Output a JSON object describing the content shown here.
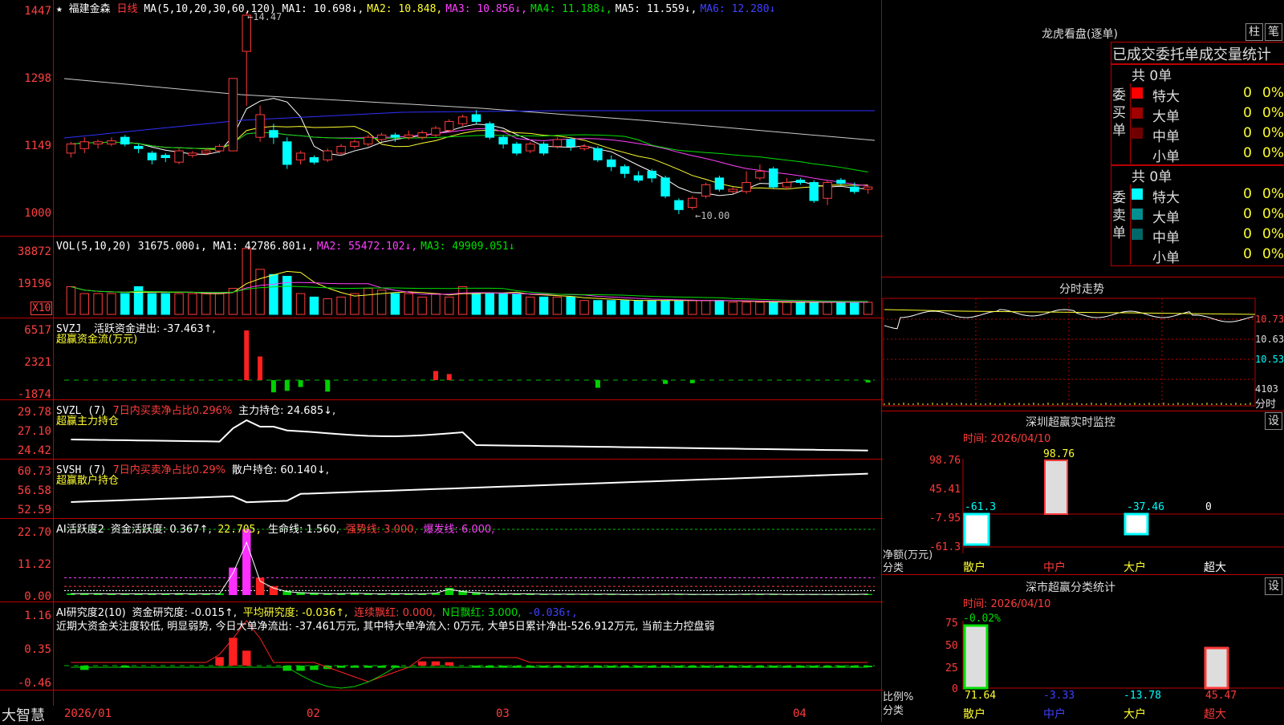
{
  "stock": {
    "star": "★",
    "name": "福建金森",
    "period": "日线"
  },
  "ma_legend": {
    "label": "MA(5,10,20,30,60,120)",
    "items": [
      {
        "t": "MA1: 10.698↓,",
        "color": "#ffffff"
      },
      {
        "t": "MA2: 10.848,",
        "color": "#ffff30"
      },
      {
        "t": "MA3: 10.856↓,",
        "color": "#ff40ff"
      },
      {
        "t": "MA4: 11.188↓,",
        "color": "#00e000"
      },
      {
        "t": "MA5: 11.559↓,",
        "color": "#ffffff"
      },
      {
        "t": "MA6: 12.280↓",
        "color": "#4040ff"
      }
    ]
  },
  "price_axis": [
    "1447",
    "1298",
    "1149",
    "1000"
  ],
  "price_marks": {
    "high": "14.47",
    "low": "10.00"
  },
  "vol_legend": {
    "label": "VOL(5,10,20)",
    "value": "31675.000↓,",
    "items": [
      {
        "t": "MA1: 42786.801↓,",
        "color": "#ffffff"
      },
      {
        "t": "MA2: 55472.102↓,",
        "color": "#ff40ff"
      },
      {
        "t": "MA3: 49909.051↓",
        "color": "#00e000"
      }
    ]
  },
  "vol_axis": [
    "38872",
    "19196"
  ],
  "vol_unit": "X10",
  "svzj": {
    "label": "SVZJ",
    "title": "活跃资金进出: -37.463↑,",
    "sub": "超赢资金流(万元)",
    "axis": [
      "6517",
      "2321",
      "-1874"
    ]
  },
  "svzl": {
    "label": "SVZL (7)",
    "a": "7日内买卖净占比0.296%",
    "b": "主力持仓: 24.685↓,",
    "sub": "超赢主力持仓",
    "axis": [
      "29.78",
      "27.10",
      "24.42"
    ]
  },
  "svsh": {
    "label": "SVSH (7)",
    "a": "7日内买卖净占比0.29%",
    "b": "散户持仓: 60.140↓,",
    "sub": "超赢散户持仓",
    "axis": [
      "60.73",
      "56.58",
      "52.59"
    ]
  },
  "ai1": {
    "label": "AI活跃度2",
    "a": "资金活跃度: 0.367↑,",
    "b": "22.705,",
    "c": "生命线: 1.560,",
    "d": "强势线: 3.000,",
    "e": "爆发线: 6.000,",
    "axis": [
      "22.70",
      "11.22",
      "0.00"
    ]
  },
  "ai2": {
    "label": "AI研究度2(10)",
    "a": "资金研究度: -0.015↑,",
    "b": "平均研究度: -0.036↑,",
    "c": "连续飘红: 0.000,",
    "d": "N日飘红: 3.000,",
    "e": "-0.036↑,",
    "axis": [
      "1.16",
      "0.35",
      "-0.46"
    ],
    "comment": "近期大资金关注度较低, 明显弱势, 今日大单净流出: -37.461万元, 其中特大单净流入: 0万元, 大单5日累计净出-526.912万元, 当前主力控盘弱"
  },
  "xaxis": {
    "brand": "大智慧",
    "labels": [
      "2026/01",
      "02",
      "03",
      "04"
    ]
  },
  "side": {
    "lh_title": "龙虎看盘(逐单)",
    "btn_zhu": "柱",
    "btn_bi": "笔",
    "tabs": "已成交委托单成交量统计",
    "buy": {
      "side": "委买单",
      "total": "共 0单",
      "rows": [
        {
          "label": "特大",
          "n": "0",
          "p": "0%",
          "color": "#ff0000"
        },
        {
          "label": "大单",
          "n": "0",
          "p": "0%",
          "color": "#a00000"
        },
        {
          "label": "中单",
          "n": "0",
          "p": "0%",
          "color": "#700000"
        },
        {
          "label": "小单",
          "n": "0",
          "p": "0%",
          "color": "#000000"
        }
      ]
    },
    "sell": {
      "side": "委卖单",
      "total": "共 0单",
      "rows": [
        {
          "label": "特大",
          "n": "0",
          "p": "0%",
          "color": "#00ffff"
        },
        {
          "label": "大单",
          "n": "0",
          "p": "0%",
          "color": "#009090"
        },
        {
          "label": "中单",
          "n": "0",
          "p": "0%",
          "color": "#006868"
        },
        {
          "label": "小单",
          "n": "0",
          "p": "0%",
          "color": "#000000"
        }
      ]
    },
    "fs_title": "分时走势",
    "fs_axis": [
      "10.73",
      "10.63",
      "10.53",
      "4103",
      "分时"
    ],
    "sz_title": "深圳超赢实时监控",
    "sz_set": "设",
    "sz_time": "时间: 2026/04/10",
    "sz_axis": [
      "98.76",
      "45.41",
      "-7.95",
      "-61.3"
    ],
    "sz_ylabel": "净额(万元)",
    "sz_xlabel": "分类",
    "sz_values": {
      "sanhu": "-61.3",
      "zhonghu": "98.76",
      "dahu": "-37.46",
      "chaoda": "0"
    },
    "cats": [
      "散户",
      "中户",
      "大户",
      "超大"
    ],
    "ss_title": "深市超赢分类统计",
    "ss_set": "设",
    "ss_time": "时间: 2026/04/10",
    "ss_axis": [
      "75",
      "50",
      "25",
      "0"
    ],
    "ss_top": "-0.02%",
    "ss_ylabel": "比例%",
    "ss_xlabel": "分类",
    "ss_values": [
      "71.64",
      "-3.33",
      "-13.78",
      "45.47"
    ]
  },
  "chart_data": {
    "type": "candlestick",
    "high": 14.47,
    "low": 10.0,
    "candles": [
      {
        "o": 11.35,
        "c": 11.55,
        "h": 11.6,
        "l": 11.25
      },
      {
        "o": 11.45,
        "c": 11.6,
        "h": 11.7,
        "l": 11.35
      },
      {
        "o": 11.55,
        "c": 11.6,
        "h": 11.65,
        "l": 11.45
      },
      {
        "o": 11.55,
        "c": 11.62,
        "h": 11.7,
        "l": 11.5
      },
      {
        "o": 11.7,
        "c": 11.55,
        "h": 11.75,
        "l": 11.5
      },
      {
        "o": 11.5,
        "c": 11.45,
        "h": 11.55,
        "l": 11.35
      },
      {
        "o": 11.35,
        "c": 11.2,
        "h": 11.4,
        "l": 11.1
      },
      {
        "o": 11.3,
        "c": 11.25,
        "h": 11.35,
        "l": 11.15
      },
      {
        "o": 11.15,
        "c": 11.4,
        "h": 11.45,
        "l": 11.1
      },
      {
        "o": 11.3,
        "c": 11.35,
        "h": 11.4,
        "l": 11.25
      },
      {
        "o": 11.35,
        "c": 11.4,
        "h": 11.45,
        "l": 11.3
      },
      {
        "o": 11.4,
        "c": 11.5,
        "h": 11.55,
        "l": 11.35
      },
      {
        "o": 11.4,
        "c": 13.0,
        "h": 13.0,
        "l": 11.4
      },
      {
        "o": 13.6,
        "c": 14.4,
        "h": 14.47,
        "l": 12.4
      },
      {
        "o": 11.7,
        "c": 12.2,
        "h": 12.4,
        "l": 11.6
      },
      {
        "o": 11.85,
        "c": 11.7,
        "h": 12.0,
        "l": 11.55
      },
      {
        "o": 11.6,
        "c": 11.1,
        "h": 11.7,
        "l": 11.0
      },
      {
        "o": 11.2,
        "c": 11.35,
        "h": 11.4,
        "l": 11.1
      },
      {
        "o": 11.25,
        "c": 11.15,
        "h": 11.3,
        "l": 11.1
      },
      {
        "o": 11.2,
        "c": 11.4,
        "h": 11.45,
        "l": 11.15
      },
      {
        "o": 11.35,
        "c": 11.5,
        "h": 11.55,
        "l": 11.3
      },
      {
        "o": 11.5,
        "c": 11.6,
        "h": 11.65,
        "l": 11.45
      },
      {
        "o": 11.55,
        "c": 11.7,
        "h": 11.75,
        "l": 11.5
      },
      {
        "o": 11.65,
        "c": 11.75,
        "h": 11.8,
        "l": 11.6
      },
      {
        "o": 11.75,
        "c": 11.7,
        "h": 11.8,
        "l": 11.6
      },
      {
        "o": 11.7,
        "c": 11.75,
        "h": 11.85,
        "l": 11.65
      },
      {
        "o": 11.7,
        "c": 11.8,
        "h": 11.85,
        "l": 11.65
      },
      {
        "o": 11.75,
        "c": 11.9,
        "h": 11.95,
        "l": 11.7
      },
      {
        "o": 11.85,
        "c": 12.05,
        "h": 12.1,
        "l": 11.8
      },
      {
        "o": 12.0,
        "c": 12.15,
        "h": 12.2,
        "l": 11.95
      },
      {
        "o": 12.2,
        "c": 12.05,
        "h": 12.3,
        "l": 12.0
      },
      {
        "o": 12.0,
        "c": 11.7,
        "h": 12.05,
        "l": 11.65
      },
      {
        "o": 11.7,
        "c": 11.55,
        "h": 11.75,
        "l": 11.45
      },
      {
        "o": 11.55,
        "c": 11.35,
        "h": 11.6,
        "l": 11.3
      },
      {
        "o": 11.4,
        "c": 11.55,
        "h": 11.6,
        "l": 11.35
      },
      {
        "o": 11.55,
        "c": 11.35,
        "h": 11.6,
        "l": 11.3
      },
      {
        "o": 11.5,
        "c": 11.65,
        "h": 11.7,
        "l": 11.45
      },
      {
        "o": 11.65,
        "c": 11.5,
        "h": 11.7,
        "l": 11.4
      },
      {
        "o": 11.45,
        "c": 11.5,
        "h": 11.55,
        "l": 11.4
      },
      {
        "o": 11.45,
        "c": 11.2,
        "h": 11.5,
        "l": 11.15
      },
      {
        "o": 11.2,
        "c": 11.05,
        "h": 11.3,
        "l": 10.95
      },
      {
        "o": 11.05,
        "c": 10.9,
        "h": 11.1,
        "l": 10.8
      },
      {
        "o": 10.85,
        "c": 10.75,
        "h": 10.95,
        "l": 10.7
      },
      {
        "o": 10.95,
        "c": 10.8,
        "h": 11.0,
        "l": 10.7
      },
      {
        "o": 10.8,
        "c": 10.4,
        "h": 10.85,
        "l": 10.35
      },
      {
        "o": 10.3,
        "c": 10.1,
        "h": 10.35,
        "l": 10.0
      },
      {
        "o": 10.15,
        "c": 10.35,
        "h": 10.4,
        "l": 10.1
      },
      {
        "o": 10.4,
        "c": 10.65,
        "h": 10.7,
        "l": 10.35
      },
      {
        "o": 10.8,
        "c": 10.55,
        "h": 10.85,
        "l": 10.5
      },
      {
        "o": 10.5,
        "c": 10.55,
        "h": 10.6,
        "l": 10.45
      },
      {
        "o": 10.5,
        "c": 10.7,
        "h": 10.95,
        "l": 10.45
      },
      {
        "o": 10.8,
        "c": 10.95,
        "h": 11.1,
        "l": 10.75
      },
      {
        "o": 11.0,
        "c": 10.6,
        "h": 11.05,
        "l": 10.55
      },
      {
        "o": 10.6,
        "c": 10.7,
        "h": 10.8,
        "l": 10.55
      },
      {
        "o": 10.75,
        "c": 10.7,
        "h": 10.8,
        "l": 10.65
      },
      {
        "o": 10.7,
        "c": 10.3,
        "h": 10.75,
        "l": 10.25
      },
      {
        "o": 10.35,
        "c": 10.7,
        "h": 10.75,
        "l": 10.2
      },
      {
        "o": 10.75,
        "c": 10.68,
        "h": 10.8,
        "l": 10.65
      },
      {
        "o": 10.6,
        "c": 10.5,
        "h": 10.7,
        "l": 10.45
      },
      {
        "o": 10.55,
        "c": 10.6,
        "h": 10.65,
        "l": 10.45
      }
    ],
    "volume": [
      16,
      12,
      12,
      12,
      12,
      16,
      12,
      12,
      12,
      12,
      12,
      12,
      15,
      38,
      26,
      23,
      22,
      12,
      10,
      9,
      10,
      12,
      15,
      14,
      12,
      12,
      10,
      12,
      10,
      16,
      12,
      12,
      12,
      12,
      10,
      10,
      10,
      10,
      8,
      8,
      8,
      8,
      8,
      8,
      8,
      8,
      8,
      8,
      8,
      7,
      7,
      7,
      7,
      7,
      7,
      7,
      7,
      7,
      7,
      7
    ],
    "svzj": [
      0,
      0,
      0,
      0,
      0,
      0,
      0,
      0,
      0,
      0,
      0,
      0,
      0,
      6517,
      3100,
      -1600,
      -1400,
      -900,
      0,
      -1500,
      0,
      0,
      0,
      0,
      0,
      0,
      0,
      1200,
      800,
      0,
      0,
      0,
      0,
      0,
      0,
      0,
      0,
      0,
      0,
      -1000,
      0,
      0,
      0,
      0,
      -500,
      0,
      -400,
      0,
      0,
      0,
      0,
      0,
      0,
      0,
      0,
      0,
      0,
      0,
      0,
      -300
    ],
    "ai1": [
      0.6,
      0.6,
      0.6,
      0.5,
      0.5,
      0.5,
      0.5,
      0.5,
      0.6,
      0.5,
      0.5,
      0.6,
      9.5,
      22.7,
      6.0,
      3.0,
      1.5,
      1.0,
      0.8,
      0.6,
      0.6,
      0.8,
      0.6,
      0.5,
      0.6,
      0.5,
      0.5,
      0.8,
      2.5,
      1.5,
      1.0,
      0.6,
      0.5,
      0.5,
      0.5,
      0.4,
      0.4,
      0.4,
      0.4,
      0.4,
      0.4,
      0.3,
      0.3,
      0.3,
      0.4,
      0.4,
      0.3,
      0.3,
      0.3,
      0.3,
      0.4,
      0.4,
      0.4,
      0.3,
      0.3,
      0.3,
      0.3,
      0.3,
      0.3,
      0.37
    ],
    "ai2": [
      0,
      -0.1,
      0,
      0,
      -0.05,
      0,
      0,
      0,
      0,
      0,
      0,
      0.2,
      0.65,
      0.35,
      0,
      0,
      -0.12,
      -0.12,
      -0.1,
      -0.08,
      -0.05,
      -0.05,
      -0.05,
      -0.05,
      -0.05,
      0,
      0.1,
      0.1,
      0.08,
      0,
      -0.05,
      -0.05,
      -0.05,
      -0.05,
      -0.05,
      -0.05,
      -0.05,
      -0.05,
      -0.05,
      -0.05,
      -0.05,
      -0.05,
      -0.05,
      -0.05,
      -0.05,
      -0.05,
      -0.05,
      -0.05,
      -0.05,
      -0.05,
      -0.05,
      -0.05,
      -0.05,
      -0.05,
      -0.05,
      -0.05,
      -0.05,
      -0.05,
      -0.05,
      -0.015
    ]
  }
}
